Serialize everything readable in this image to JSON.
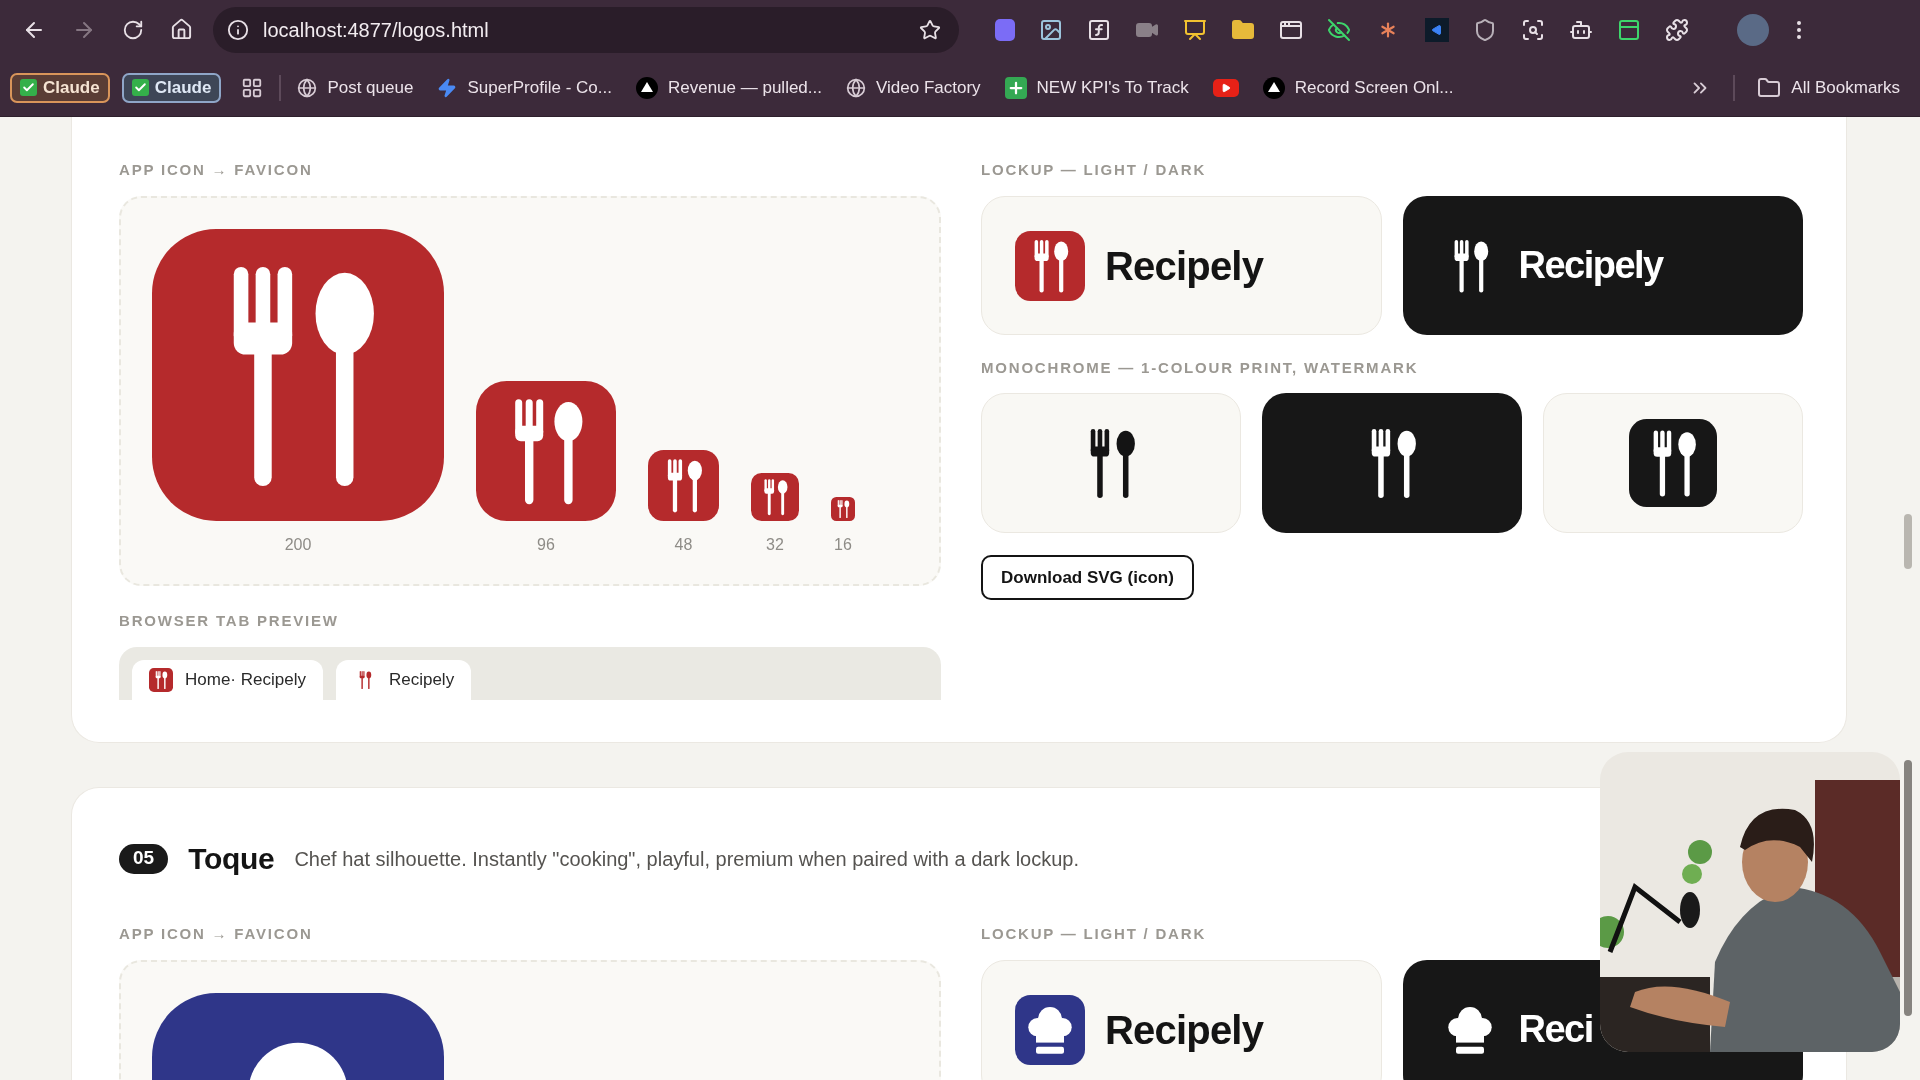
{
  "browser": {
    "url": "localhost:4877/logos.html",
    "groups": [
      {
        "label": "Claude",
        "color": "#d9955a"
      },
      {
        "label": "Claude",
        "color": "#8fa6c8"
      }
    ],
    "bookmarks": [
      {
        "label": "Post queue",
        "kind": "globe"
      },
      {
        "label": "SuperProfile - Co...",
        "kind": "bolt"
      },
      {
        "label": "Revenue — pulled...",
        "kind": "triangle"
      },
      {
        "label": "Video Factory",
        "kind": "globe"
      },
      {
        "label": "NEW KPI's To Track",
        "kind": "sheet"
      },
      {
        "kind": "youtube"
      },
      {
        "label": "Record Screen Onl...",
        "kind": "triangle"
      }
    ],
    "all_bookmarks": "All Bookmarks"
  },
  "sections": [
    {
      "kind": "cutlery",
      "color": "#b52a2c",
      "app_icon_label": "APP ICON → FAVICON",
      "sizes": [
        "200",
        "96",
        "48",
        "32",
        "16"
      ],
      "tab_preview_label": "BROWSER TAB PREVIEW",
      "preview_tabs": [
        {
          "title": "Home· Recipely",
          "kind": "app"
        },
        {
          "title": "Recipely",
          "kind": "glyph"
        }
      ],
      "lockup_label": "LOCKUP — LIGHT / DARK",
      "lockups": [
        {
          "kind": "light",
          "name": "Recipely"
        },
        {
          "kind": "dark",
          "name": "Recipely"
        }
      ],
      "mono_label": "MONOCHROME — 1-COLOUR PRINT, WATERMARK",
      "mono": [
        {
          "kind": "light"
        },
        {
          "kind": "dark"
        },
        {
          "kind": "tile"
        }
      ],
      "button": "Download SVG (icon)"
    },
    {
      "number": "05",
      "name": "Toque",
      "description": "Chef hat silhouette. Instantly \"cooking\", playful, premium when paired with a dark lockup.",
      "kind": "chef-hat",
      "color": "#2f3689",
      "app_icon_label": "APP ICON → FAVICON",
      "lockup_label": "LOCKUP — LIGHT / DARK",
      "lockups": [
        {
          "kind": "light",
          "name": "Recipely"
        },
        {
          "kind": "dark",
          "name": "Reci"
        }
      ]
    }
  ]
}
